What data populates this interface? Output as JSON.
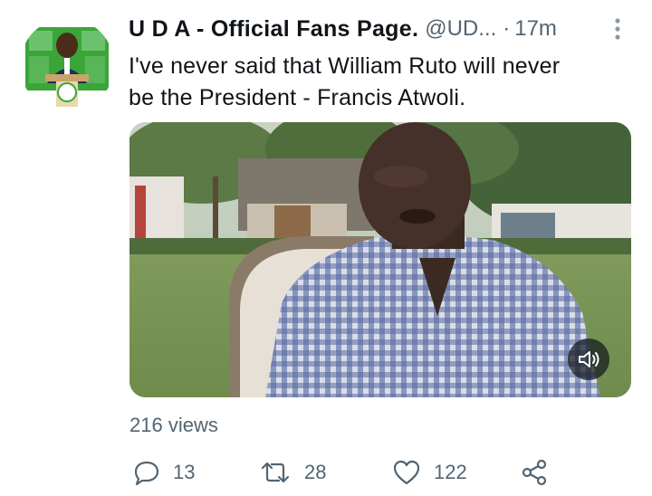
{
  "tweet": {
    "author": {
      "display_name": "U D A - Official Fans Page.",
      "handle": "@UD...",
      "separator": "·",
      "time": "17m",
      "avatar_icon": "profile-photo",
      "more_icon": "more-vertical-icon"
    },
    "text_line_1": "I've never said that William Ruto will never",
    "text_line_2": "be the President - Francis Atwoli.",
    "media": {
      "type": "video",
      "mute_icon": "speaker-icon"
    },
    "views_label": "216 views",
    "actions": {
      "reply": {
        "icon": "reply-icon",
        "count": "13"
      },
      "retweet": {
        "icon": "retweet-icon",
        "count": "28"
      },
      "like": {
        "icon": "heart-icon",
        "count": "122"
      },
      "share": {
        "icon": "share-icon"
      }
    }
  },
  "colors": {
    "text_primary": "#0f1419",
    "text_secondary": "#536471",
    "avatar_green": "#3aa63a"
  }
}
